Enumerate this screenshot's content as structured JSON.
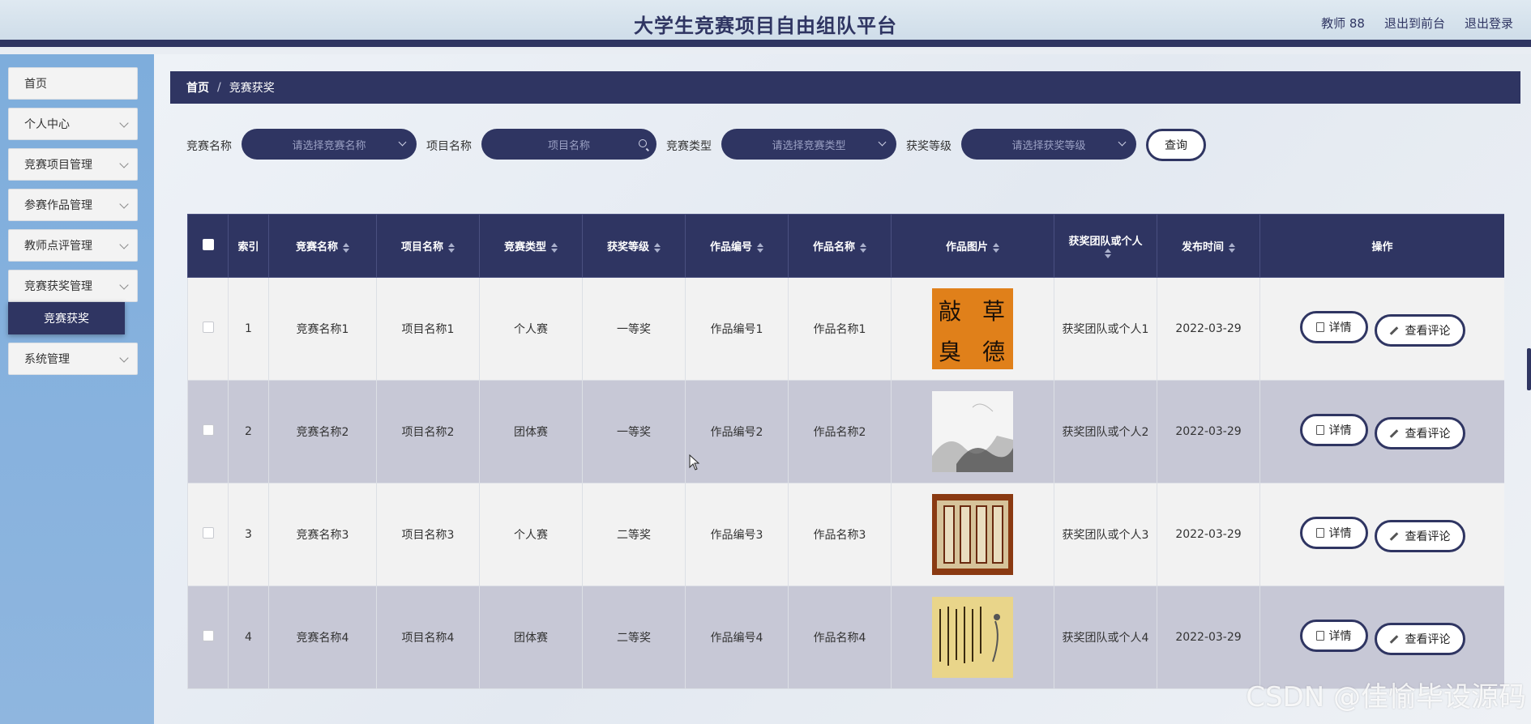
{
  "header": {
    "title": "大学生竞赛项目自由组队平台",
    "user_label": "教师 88",
    "exit_front": "退出到前台",
    "logout": "退出登录"
  },
  "sidebar": {
    "items": [
      {
        "label": "首页",
        "has_chevron": false
      },
      {
        "label": "个人中心",
        "has_chevron": true
      },
      {
        "label": "竞赛项目管理",
        "has_chevron": true
      },
      {
        "label": "参赛作品管理",
        "has_chevron": true
      },
      {
        "label": "教师点评管理",
        "has_chevron": true
      },
      {
        "label": "竞赛获奖管理",
        "has_chevron": true
      },
      {
        "label": "系统管理",
        "has_chevron": true
      }
    ],
    "active_sub": "竞赛获奖"
  },
  "breadcrumb": {
    "home": "首页",
    "separator": "/",
    "current": "竞赛获奖"
  },
  "search": {
    "comp_name_label": "竞赛名称",
    "comp_name_placeholder": "请选择竞赛名称",
    "project_label": "项目名称",
    "project_placeholder": "项目名称",
    "type_label": "竞赛类型",
    "type_placeholder": "请选择竞赛类型",
    "level_label": "获奖等级",
    "level_placeholder": "请选择获奖等级",
    "query_label": "查询"
  },
  "table": {
    "headers": {
      "index": "索引",
      "comp_name": "竞赛名称",
      "project": "项目名称",
      "type": "竞赛类型",
      "level": "获奖等级",
      "work_no": "作品编号",
      "work_name": "作品名称",
      "image": "作品图片",
      "winner": "获奖团队或个人",
      "date": "发布时间",
      "ops": "操作"
    },
    "rows": [
      {
        "index": "1",
        "comp_name": "竞赛名称1",
        "project": "项目名称1",
        "type": "个人赛",
        "level": "一等奖",
        "work_no": "作品编号1",
        "work_name": "作品名称1",
        "winner": "获奖团队或个人1",
        "date": "2022-03-29",
        "image_icon": "calligraphy-orange-image"
      },
      {
        "index": "2",
        "comp_name": "竞赛名称2",
        "project": "项目名称2",
        "type": "团体赛",
        "level": "一等奖",
        "work_no": "作品编号2",
        "work_name": "作品名称2",
        "winner": "获奖团队或个人2",
        "date": "2022-03-29",
        "image_icon": "ink-landscape-image"
      },
      {
        "index": "3",
        "comp_name": "竞赛名称3",
        "project": "项目名称3",
        "type": "个人赛",
        "level": "二等奖",
        "work_no": "作品编号3",
        "work_name": "作品名称3",
        "winner": "获奖团队或个人3",
        "date": "2022-03-29",
        "image_icon": "scroll-panels-image"
      },
      {
        "index": "4",
        "comp_name": "竞赛名称4",
        "project": "项目名称4",
        "type": "团体赛",
        "level": "二等奖",
        "work_no": "作品编号4",
        "work_name": "作品名称4",
        "winner": "获奖团队或个人4",
        "date": "2022-03-29",
        "image_icon": "calligraphy-yellow-image"
      }
    ],
    "detail_label": "详情",
    "review_label": "查看评论"
  },
  "watermark": "CSDN @佳愉毕设源码",
  "colors": {
    "primary": "#2f3562",
    "sidebar": "#8bb3de",
    "row_alt": "#c7c8d6"
  }
}
